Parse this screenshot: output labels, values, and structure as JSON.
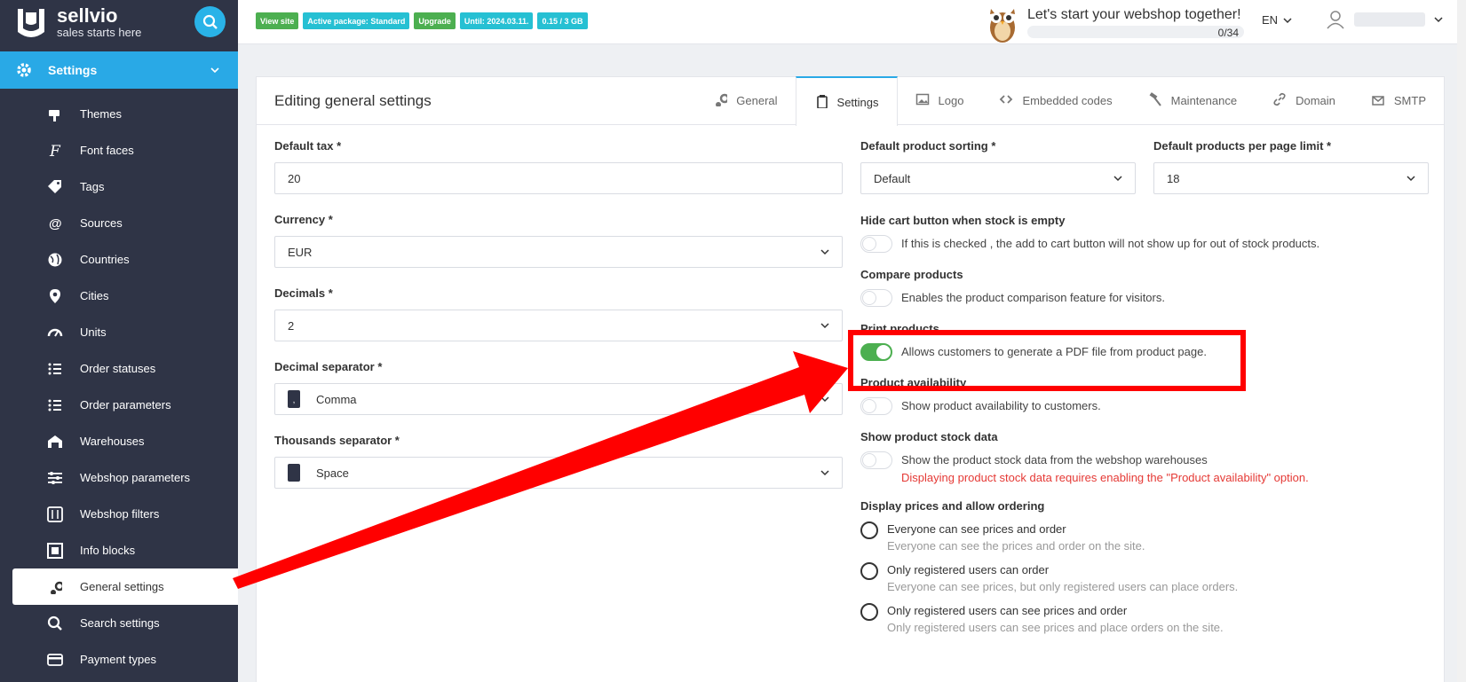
{
  "brand": {
    "name": "sellvio",
    "tagline": "sales starts here"
  },
  "nav": {
    "section_label": "Settings",
    "items": [
      {
        "label": "Themes",
        "icon": "themes-icon"
      },
      {
        "label": "Font faces",
        "icon": "font-icon"
      },
      {
        "label": "Tags",
        "icon": "tags-icon"
      },
      {
        "label": "Sources",
        "icon": "at-icon"
      },
      {
        "label": "Countries",
        "icon": "globe-icon"
      },
      {
        "label": "Cities",
        "icon": "location-pin-icon"
      },
      {
        "label": "Units",
        "icon": "gauge-icon"
      },
      {
        "label": "Order statuses",
        "icon": "list-icon"
      },
      {
        "label": "Order parameters",
        "icon": "list-icon"
      },
      {
        "label": "Warehouses",
        "icon": "warehouse-icon"
      },
      {
        "label": "Webshop parameters",
        "icon": "sliders-icon"
      },
      {
        "label": "Webshop filters",
        "icon": "filter-icon"
      },
      {
        "label": "Info blocks",
        "icon": "info-block-icon"
      },
      {
        "label": "General settings",
        "icon": "gears-icon",
        "active": true
      },
      {
        "label": "Search settings",
        "icon": "search-icon"
      },
      {
        "label": "Payment types",
        "icon": "credit-card-icon"
      }
    ]
  },
  "topbar": {
    "badges": [
      {
        "label": "View site",
        "color": "#4caf50"
      },
      {
        "label": "Active package: Standard",
        "color": "#26c0d3"
      },
      {
        "label": "Upgrade",
        "color": "#4caf50"
      },
      {
        "label": "Until: 2024.03.11.",
        "color": "#26c0d3"
      },
      {
        "label": "0.15 / 3 GB",
        "color": "#26c0d3"
      }
    ],
    "promo_title": "Let's start your webshop together!",
    "progress_count": "0/34",
    "language": "EN"
  },
  "card": {
    "title": "Editing general settings",
    "tabs": [
      {
        "label": "General",
        "icon": "gears-icon"
      },
      {
        "label": "Settings",
        "icon": "clipboard-icon",
        "active": true
      },
      {
        "label": "Logo",
        "icon": "image-icon"
      },
      {
        "label": "Embedded codes",
        "icon": "code-icon"
      },
      {
        "label": "Maintenance",
        "icon": "hammer-icon"
      },
      {
        "label": "Domain",
        "icon": "link-icon"
      },
      {
        "label": "SMTP",
        "icon": "mail-icon"
      }
    ]
  },
  "form": {
    "default_tax": {
      "label": "Default tax *",
      "value": "20"
    },
    "currency": {
      "label": "Currency *",
      "value": "EUR"
    },
    "decimals": {
      "label": "Decimals *",
      "value": "2"
    },
    "decimal_separator": {
      "label": "Decimal separator *",
      "value": "Comma",
      "swatch": ","
    },
    "thousands_separator": {
      "label": "Thousands separator *",
      "value": "Space"
    },
    "sorting": {
      "label": "Default product sorting *",
      "value": "Default"
    },
    "per_page": {
      "label": "Default products per page limit *",
      "value": "18"
    },
    "toggles": [
      {
        "title": "Hide cart button when stock is empty",
        "desc": "If this is checked , the add to cart button will not show up for out of stock products.",
        "on": false
      },
      {
        "title": "Compare products",
        "desc": "Enables the product comparison feature for visitors.",
        "on": false
      },
      {
        "title": "Print products",
        "desc": "Allows customers to generate a PDF file from product page.",
        "on": true
      },
      {
        "title": "Product availability",
        "desc": "Show product availability to customers.",
        "on": false
      },
      {
        "title": "Show product stock data",
        "desc": "Show the product stock data from the webshop warehouses",
        "warning": "Displaying product stock data requires enabling the \"Product availability\" option.",
        "on": false
      }
    ],
    "prices": {
      "title": "Display prices and allow ordering",
      "options": [
        {
          "label": "Everyone can see prices and order",
          "sub": "Everyone can see the prices and order on the site."
        },
        {
          "label": "Only registered users can order",
          "sub": "Everyone can see prices, but only registered users can place orders."
        },
        {
          "label": "Only registered users can see prices and order",
          "sub": "Only registered users can see prices and place orders on the site."
        }
      ]
    }
  },
  "colors": {
    "accent": "#29a9e6",
    "sidebar": "#2f3446",
    "toggle_on": "#4caf50",
    "highlight": "#ff0000"
  }
}
